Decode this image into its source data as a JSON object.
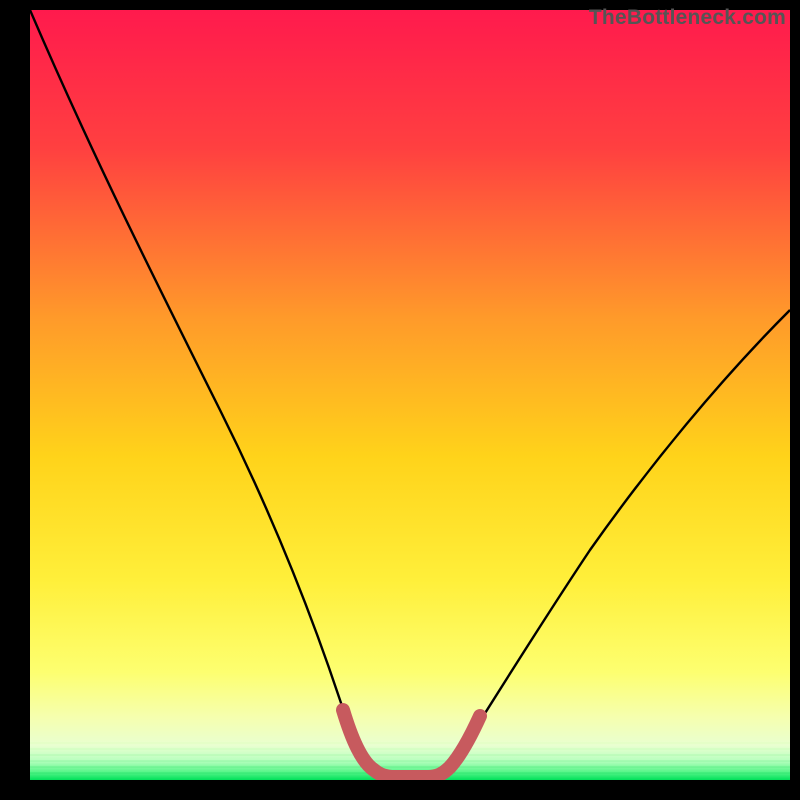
{
  "watermark": "TheBottleneck.com",
  "colors": {
    "frame": "#000000",
    "grad_top": "#ff1a4d",
    "grad_mid_high": "#ff7a2a",
    "grad_mid": "#ffd31a",
    "grad_low": "#fff76a",
    "grad_lower": "#f8ffab",
    "grad_lowest": "#7cff9e",
    "grad_baseline": "#00e05a",
    "curve": "#000000",
    "highlight": "#c75a5e"
  },
  "chart_data": {
    "type": "line",
    "title": "",
    "xlabel": "",
    "ylabel": "",
    "xlim": [
      0,
      100
    ],
    "ylim": [
      0,
      100
    ],
    "series": [
      {
        "name": "bottleneck-curve",
        "x": [
          0,
          5,
          10,
          15,
          20,
          25,
          30,
          35,
          38,
          40,
          43,
          46,
          49,
          52,
          55,
          60,
          65,
          70,
          75,
          80,
          85,
          90,
          95,
          100
        ],
        "y": [
          100,
          90,
          80,
          70,
          60,
          50,
          40,
          28,
          18,
          10,
          2,
          0,
          0,
          1,
          4,
          11,
          19,
          27,
          34,
          41,
          47,
          52,
          57,
          61
        ]
      },
      {
        "name": "optimal-range-highlight",
        "x": [
          40,
          43,
          46,
          49,
          52,
          55
        ],
        "y": [
          10,
          2,
          0,
          0,
          1,
          4
        ]
      }
    ],
    "grid": false,
    "legend": false
  }
}
